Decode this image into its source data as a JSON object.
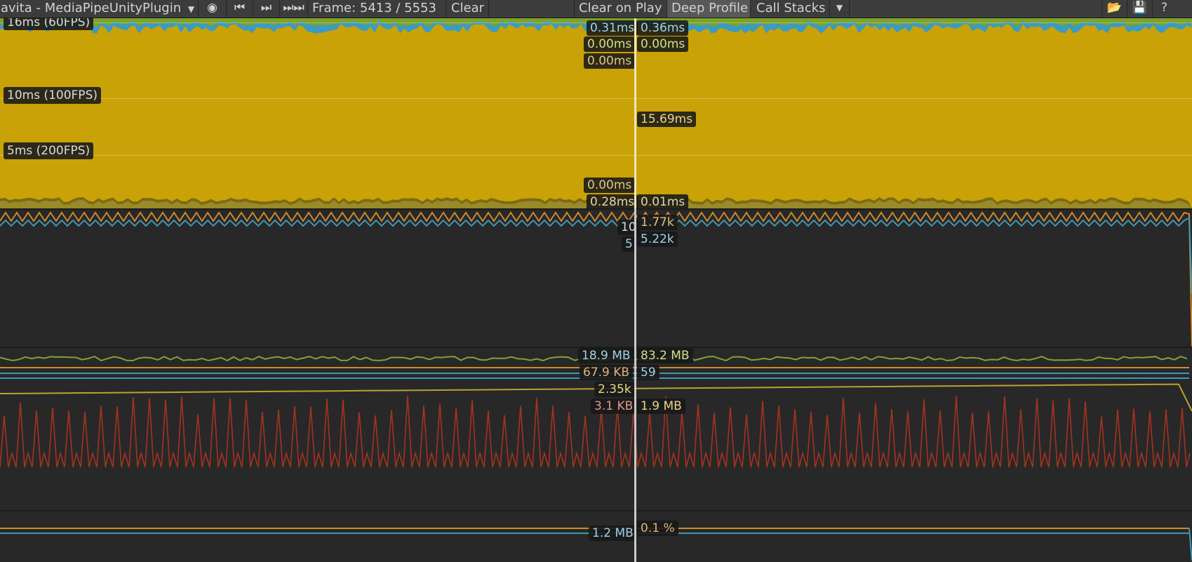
{
  "toolbar": {
    "target": "avita - MediaPipeUnityPlugin",
    "target_dropdown_icon": "dropdown-arrow-icon",
    "record_icon": "record-icon",
    "prev_frame_icon": "previous-frame-icon",
    "next_frame_icon": "next-frame-icon",
    "last_frame_icon": "last-frame-icon",
    "frame_label": "Frame: 5413 / 5553",
    "clear": "Clear",
    "clear_on_play": "Clear on Play",
    "deep_profile": "Deep Profile",
    "call_stacks": "Call Stacks",
    "call_stacks_dropdown_icon": "dropdown-arrow-icon",
    "load_icon": "load-icon",
    "save_icon": "save-icon",
    "help_icon": "help-icon"
  },
  "cpu": {
    "ticks": [
      "16ms (60FPS)",
      "10ms (100FPS)",
      "5ms (200FPS)"
    ],
    "labels_left": [
      "0.31ms",
      "0.00ms",
      "0.00ms",
      "0.00ms",
      "0.28ms"
    ],
    "labels_right": [
      "0.36ms",
      "0.00ms",
      "15.69ms",
      "0.01ms"
    ]
  },
  "rendering": {
    "labels_left": [
      "10",
      "5"
    ],
    "labels_right": [
      "1.77k",
      "5.22k"
    ]
  },
  "memory": {
    "labels_left": [
      "18.9 MB",
      "67.9 KB",
      "2.35k",
      "3.1 KB"
    ],
    "labels_right": [
      "83.2 MB",
      "59",
      "1.9 MB"
    ]
  },
  "audio": {
    "labels_left": [
      "1.2 MB"
    ],
    "labels_right": [
      "0.1 %"
    ]
  },
  "colors": {
    "cpu_scripts": "#c8a207",
    "cpu_rendering": "#3a9bc4",
    "cpu_other": "#7ea22c",
    "line_orange": "#d08a2a",
    "line_blue": "#3f97b6",
    "line_green": "#7fa23a",
    "line_yellow": "#b8a233",
    "line_red": "#a3331f"
  }
}
